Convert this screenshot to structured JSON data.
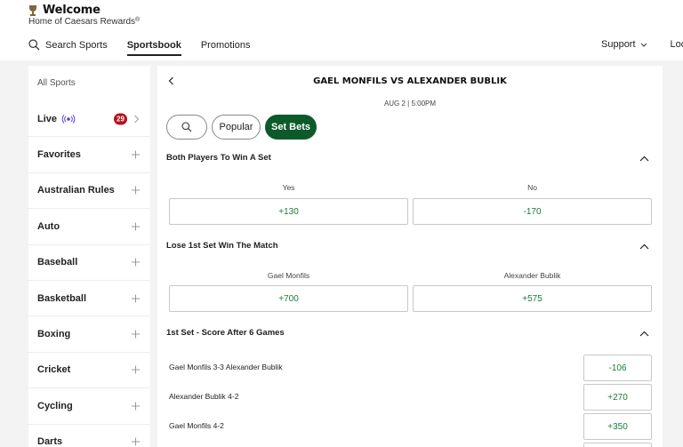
{
  "brand": {
    "title": "Welcome",
    "subtitle": "Home of Caesars Rewards",
    "reg": "®"
  },
  "nav": {
    "search": "Search Sports",
    "sportsbook": "Sportsbook",
    "promotions": "Promotions",
    "support": "Support",
    "location": "Locatio"
  },
  "sidebar": {
    "all_sports": "All Sports",
    "live": {
      "label": "Live",
      "count": "29"
    },
    "items": [
      "Favorites",
      "Australian Rules",
      "Auto",
      "Baseball",
      "Basketball",
      "Boxing",
      "Cricket",
      "Cycling",
      "Darts"
    ]
  },
  "match": {
    "title": "GAEL MONFILS VS ALEXANDER BUBLIK",
    "date": "AUG 2 | 5:00PM"
  },
  "chips": {
    "popular": "Popular",
    "set_bets": "Set Bets"
  },
  "markets": {
    "both_win_set": {
      "title": "Both Players To Win A Set",
      "yes_label": "Yes",
      "no_label": "No",
      "yes_odds": "+130",
      "no_odds": "-170"
    },
    "lose_first_win_match": {
      "title": "Lose 1st Set Win The Match",
      "p1_label": "Gael Monfils",
      "p2_label": "Alexander Bublik",
      "p1_odds": "+700",
      "p2_odds": "+575"
    },
    "first_set_score": {
      "title": "1st Set - Score After 6 Games",
      "rows": [
        {
          "label": "Gael Monfils 3-3 Alexander Bublik",
          "odds": "-106"
        },
        {
          "label": "Alexander Bublik 4-2",
          "odds": "+270"
        },
        {
          "label": "Gael Monfils 4-2",
          "odds": "+350"
        }
      ]
    }
  },
  "colors": {
    "accent_green": "#0c5a2a",
    "odds_green": "#1b7a3a",
    "live_badge": "#b5111c",
    "live_icon": "#5b3fd6"
  }
}
